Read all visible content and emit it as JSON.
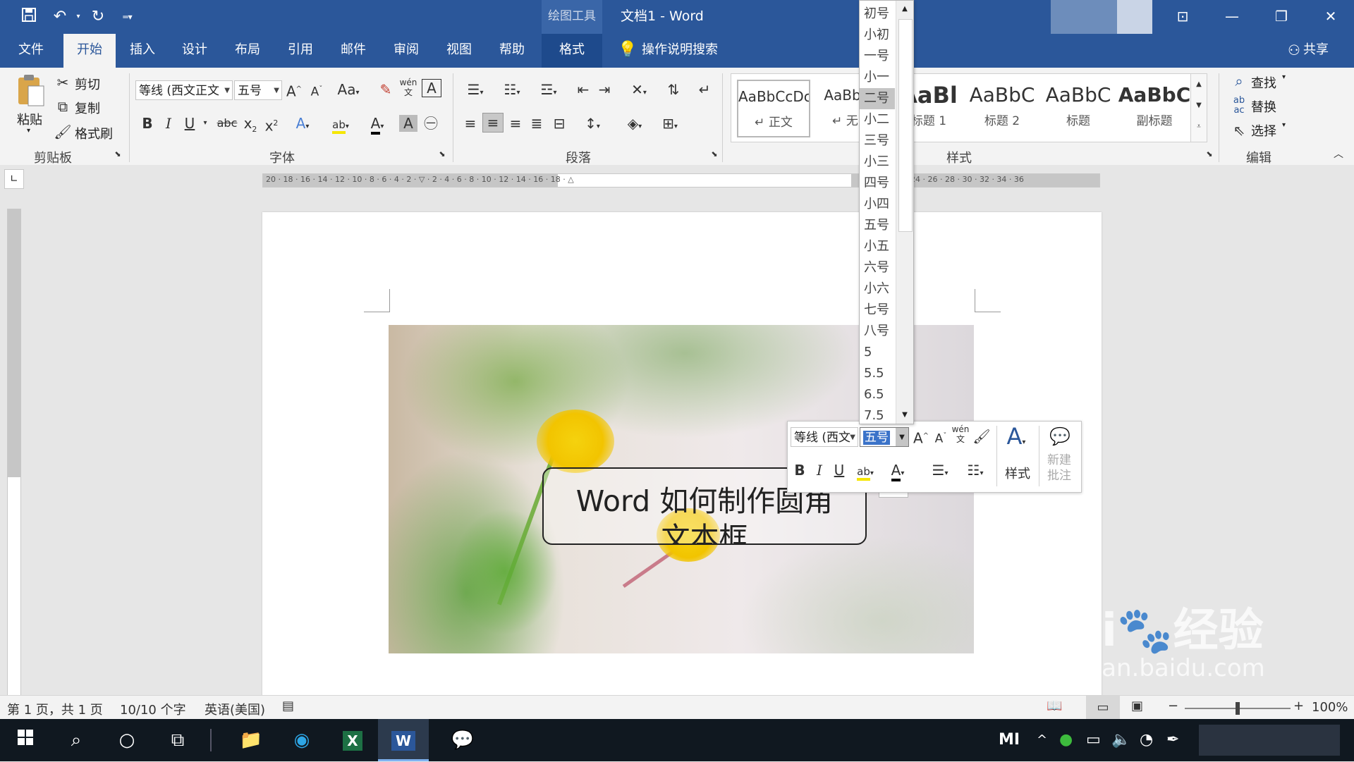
{
  "titlebar": {
    "context_tools": "绘图工具",
    "title": "文档1  -  Word",
    "qa_save_icon": "save-icon",
    "qa_undo_icon": "undo-icon",
    "qa_redo_icon": "redo-icon",
    "qa_customize_icon": "customize-icon"
  },
  "tabs": {
    "file": "文件",
    "home": "开始",
    "insert": "插入",
    "design": "设计",
    "layout": "布局",
    "references": "引用",
    "mailings": "邮件",
    "review": "审阅",
    "view": "视图",
    "help": "帮助",
    "format": "格式",
    "tell_me": "操作说明搜索",
    "share": "共享"
  },
  "ribbon": {
    "clipboard": {
      "paste": "粘贴",
      "cut": "剪切",
      "copy": "复制",
      "format_painter": "格式刷",
      "label": "剪贴板"
    },
    "font": {
      "font_name": "等线 (西文正文",
      "font_size": "五号",
      "label": "字体",
      "change_case": "Aa",
      "phonetic": "wén"
    },
    "paragraph": {
      "label": "段落"
    },
    "styles": {
      "label": "样式",
      "items": [
        {
          "preview": "AaBbCcDc",
          "name": "↵ 正文"
        },
        {
          "preview": "AaBbCc",
          "name": "↵ 无间"
        },
        {
          "preview": "AaBl",
          "name": "标题 1"
        },
        {
          "preview": "AaBbC",
          "name": "标题 2"
        },
        {
          "preview": "AaBbC",
          "name": "标题"
        },
        {
          "preview": "AaBbC",
          "name": "副标题"
        }
      ]
    },
    "editing": {
      "label": "编辑",
      "find": "查找",
      "replace": "替换",
      "select": "选择"
    }
  },
  "ruler": {
    "ticks": "20 · 18 · 16 · 14 · 12 · 10 · 8 · 6 · 4 · 2 · ▽ · 2 · 4 · 6 · 8 · 10 · 12 · 14 · 16 · 18 · △",
    "ticks_right": "24 · 26 · 28 · 30 · 32 · 34 · 36"
  },
  "font_size_dropdown": {
    "options": [
      "初号",
      "小初",
      "一号",
      "小一",
      "二号",
      "小二",
      "三号",
      "小三",
      "四号",
      "小四",
      "五号",
      "小五",
      "六号",
      "小六",
      "七号",
      "八号",
      "5",
      "5.5",
      "6.5",
      "7.5"
    ],
    "selected": "二号"
  },
  "textbox": {
    "text": "Word 如何制作圆角",
    "text_line2": "文本框"
  },
  "mini_toolbar": {
    "font_name": "等线 (西文",
    "font_size": "五号",
    "styles": "样式",
    "new_comment_1": "新建",
    "new_comment_2": "批注",
    "phonetic": "wén"
  },
  "statusbar": {
    "page": "第 1 页，共 1 页",
    "words": "10/10 个字",
    "language": "英语(美国)",
    "zoom": "100%"
  },
  "taskbar": {
    "tray_brand": "MI"
  },
  "watermark": {
    "line1": "Bai",
    "line2": "经验",
    "line3": "jingyan.baidu.com"
  }
}
